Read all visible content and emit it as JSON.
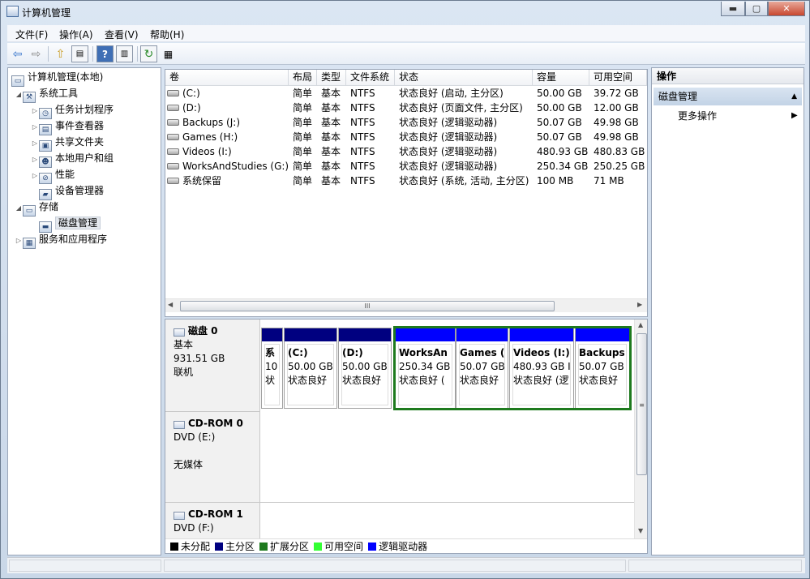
{
  "window": {
    "title": "计算机管理",
    "min": "▬",
    "max": "▢",
    "close": "✕"
  },
  "menu": [
    "文件(F)",
    "操作(A)",
    "查看(V)",
    "帮助(H)"
  ],
  "toolbar": {
    "icons": [
      "back-icon",
      "forward-icon",
      "up-folder-icon",
      "show-tree-icon",
      "help-icon",
      "show-action-pane-icon",
      "refresh-icon",
      "properties-icon"
    ]
  },
  "tree": {
    "root": "计算机管理(本地)",
    "system_tools": "系统工具",
    "task_scheduler": "任务计划程序",
    "event_viewer": "事件查看器",
    "shared_folders": "共享文件夹",
    "local_users": "本地用户和组",
    "performance": "性能",
    "device_manager": "设备管理器",
    "storage": "存储",
    "disk_management": "磁盘管理",
    "services_apps": "服务和应用程序"
  },
  "volumes": {
    "headers": [
      "卷",
      "布局",
      "类型",
      "文件系统",
      "状态",
      "容量",
      "可用空间"
    ],
    "rows": [
      [
        "(C:)",
        "简单",
        "基本",
        "NTFS",
        "状态良好 (启动, 主分区)",
        "50.00 GB",
        "39.72 GB"
      ],
      [
        "(D:)",
        "简单",
        "基本",
        "NTFS",
        "状态良好 (页面文件, 主分区)",
        "50.00 GB",
        "12.00 GB"
      ],
      [
        "Backups (J:)",
        "简单",
        "基本",
        "NTFS",
        "状态良好 (逻辑驱动器)",
        "50.07 GB",
        "49.98 GB"
      ],
      [
        "Games (H:)",
        "简单",
        "基本",
        "NTFS",
        "状态良好 (逻辑驱动器)",
        "50.07 GB",
        "49.98 GB"
      ],
      [
        "Videos (I:)",
        "简单",
        "基本",
        "NTFS",
        "状态良好 (逻辑驱动器)",
        "480.93 GB",
        "480.83 GB"
      ],
      [
        "WorksAndStudies (G:)",
        "简单",
        "基本",
        "NTFS",
        "状态良好 (逻辑驱动器)",
        "250.34 GB",
        "250.25 GB"
      ],
      [
        "系统保留",
        "简单",
        "基本",
        "NTFS",
        "状态良好 (系统, 活动, 主分区)",
        "100 MB",
        "71 MB"
      ]
    ],
    "hscroll_grip": "III"
  },
  "disks": {
    "disk0": {
      "name": "磁盘 0",
      "type": "基本",
      "size": "931.51 GB",
      "status": "联机"
    },
    "partitions": [
      {
        "l1": "系",
        "l2": "10",
        "l3": "状",
        "kind": "primary"
      },
      {
        "l1": "(C:)",
        "l2": "50.00 GB",
        "l3": "状态良好",
        "kind": "primary"
      },
      {
        "l1": "(D:)",
        "l2": "50.00 GB",
        "l3": "状态良好",
        "kind": "primary"
      },
      {
        "l1": "WorksAn",
        "l2": "250.34 GB",
        "l3": "状态良好 (",
        "kind": "logical"
      },
      {
        "l1": "Games (",
        "l2": "50.07 GB",
        "l3": "状态良好",
        "kind": "logical"
      },
      {
        "l1": "Videos  (I:)",
        "l2": "480.93 GB I",
        "l3": "状态良好 (逻",
        "kind": "logical"
      },
      {
        "l1": "Backups",
        "l2": "50.07 GB",
        "l3": "状态良好",
        "kind": "logical"
      }
    ],
    "cdrom0": {
      "name": "CD-ROM 0",
      "drive": "DVD (E:)",
      "media": "无媒体"
    },
    "cdrom1": {
      "name": "CD-ROM 1",
      "drive": "DVD (F:)"
    },
    "vscroll_grip": "≡"
  },
  "legend": [
    {
      "label": "未分配",
      "color": "#000000"
    },
    {
      "label": "主分区",
      "color": "#000080"
    },
    {
      "label": "扩展分区",
      "color": "#1e7a1e"
    },
    {
      "label": "可用空间",
      "color": "#33ff33"
    },
    {
      "label": "逻辑驱动器",
      "color": "#0000ff"
    }
  ],
  "actions": {
    "title": "操作",
    "section": "磁盘管理",
    "more": "更多操作",
    "section_arrow": "▲",
    "more_arrow": "▶"
  },
  "colors": {
    "primary": "#000080",
    "logical": "#0000ff",
    "extended": "#1e7a1e"
  }
}
